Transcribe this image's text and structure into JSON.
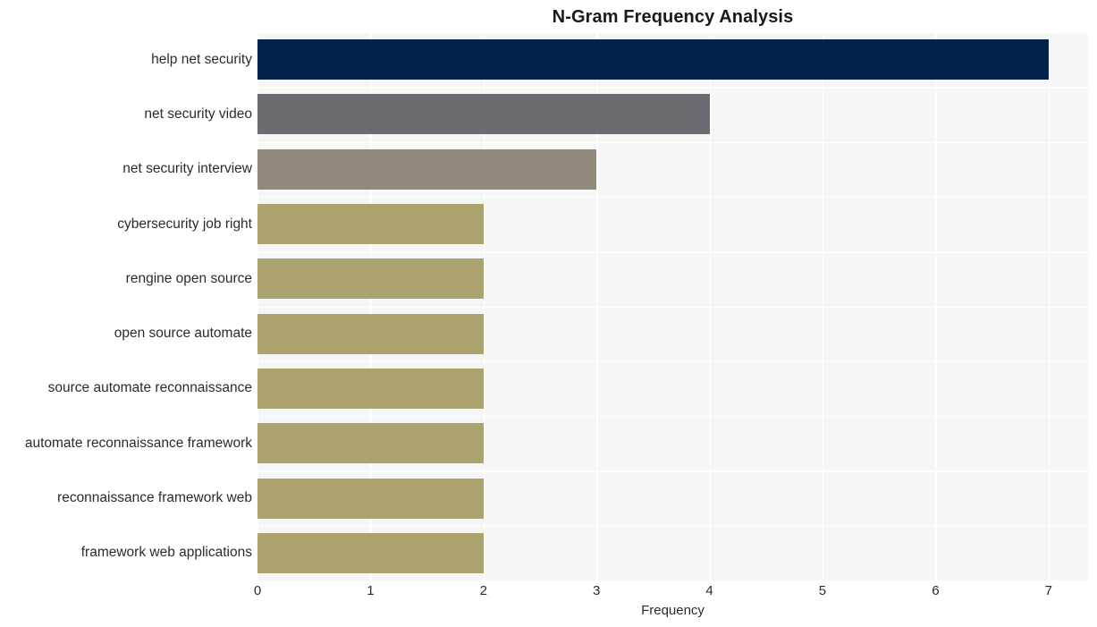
{
  "chart_data": {
    "type": "bar",
    "orientation": "horizontal",
    "title": "N-Gram Frequency Analysis",
    "xlabel": "Frequency",
    "ylabel": "",
    "xlim": [
      0,
      7.35
    ],
    "xticks": [
      0,
      1,
      2,
      3,
      4,
      5,
      6,
      7
    ],
    "xtick_labels": [
      "0",
      "1",
      "2",
      "3",
      "4",
      "5",
      "6",
      "7"
    ],
    "grid": true,
    "legend": "none",
    "categories": [
      "help net security",
      "net security video",
      "net security interview",
      "cybersecurity job right",
      "rengine open source",
      "open source automate",
      "source automate reconnaissance",
      "automate reconnaissance framework",
      "reconnaissance framework web",
      "framework web applications"
    ],
    "values": [
      7,
      4,
      3,
      2,
      2,
      2,
      2,
      2,
      2,
      2
    ],
    "bar_colors": [
      "#04224c",
      "#6c6b72",
      "#908a7c",
      "#ada36f",
      "#ada36f",
      "#ada36f",
      "#ada36f",
      "#ada36f",
      "#ada36f",
      "#ada36f"
    ]
  },
  "style": {
    "figure_background": "#ffffff",
    "plot_background": "#f6f6f7",
    "gridline_color": "#ffffff",
    "text_color": "#2b2b2b",
    "title_color": "#1a1a1a"
  }
}
